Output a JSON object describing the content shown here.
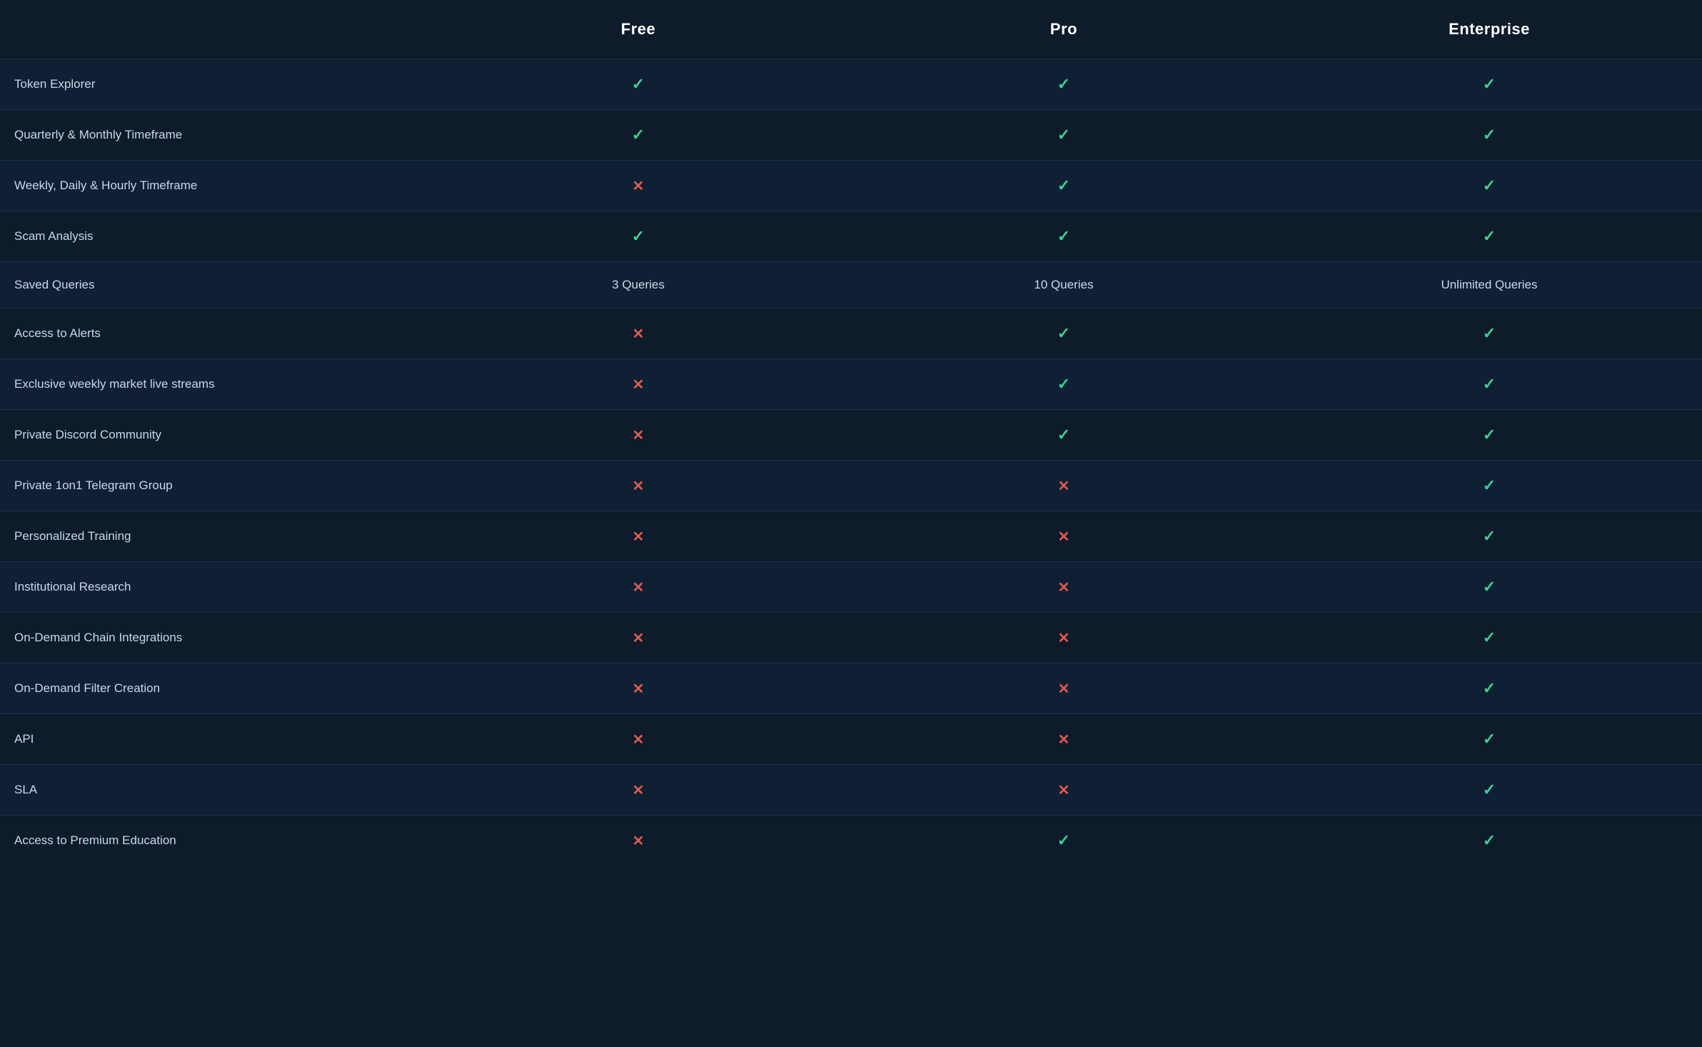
{
  "headers": {
    "feature": "",
    "free": "Free",
    "pro": "Pro",
    "enterprise": "Enterprise"
  },
  "rows": [
    {
      "feature": "Token Explorer",
      "free": "check",
      "pro": "check",
      "enterprise": "check"
    },
    {
      "feature": "Quarterly & Monthly Timeframe",
      "free": "check",
      "pro": "check",
      "enterprise": "check"
    },
    {
      "feature": "Weekly, Daily & Hourly Timeframe",
      "free": "cross",
      "pro": "check",
      "enterprise": "check"
    },
    {
      "feature": "Scam Analysis",
      "free": "check",
      "pro": "check",
      "enterprise": "check"
    },
    {
      "feature": "Saved Queries",
      "free": "3 Queries",
      "pro": "10 Queries",
      "enterprise": "Unlimited Queries"
    },
    {
      "feature": "Access to Alerts",
      "free": "cross",
      "pro": "check",
      "enterprise": "check"
    },
    {
      "feature": "Exclusive weekly market live streams",
      "free": "cross",
      "pro": "check",
      "enterprise": "check"
    },
    {
      "feature": "Private Discord Community",
      "free": "cross",
      "pro": "check",
      "enterprise": "check"
    },
    {
      "feature": "Private 1on1 Telegram Group",
      "free": "cross",
      "pro": "cross",
      "enterprise": "check"
    },
    {
      "feature": "Personalized Training",
      "free": "cross",
      "pro": "cross",
      "enterprise": "check"
    },
    {
      "feature": "Institutional Research",
      "free": "cross",
      "pro": "cross",
      "enterprise": "check"
    },
    {
      "feature": "On-Demand Chain Integrations",
      "free": "cross",
      "pro": "cross",
      "enterprise": "check"
    },
    {
      "feature": "On-Demand Filter Creation",
      "free": "cross",
      "pro": "cross",
      "enterprise": "check"
    },
    {
      "feature": "API",
      "free": "cross",
      "pro": "cross",
      "enterprise": "check"
    },
    {
      "feature": "SLA",
      "free": "cross",
      "pro": "cross",
      "enterprise": "check"
    },
    {
      "feature": "Access to Premium Education",
      "free": "cross",
      "pro": "check",
      "enterprise": "check"
    }
  ],
  "icons": {
    "check": "✓",
    "cross": "✕"
  }
}
